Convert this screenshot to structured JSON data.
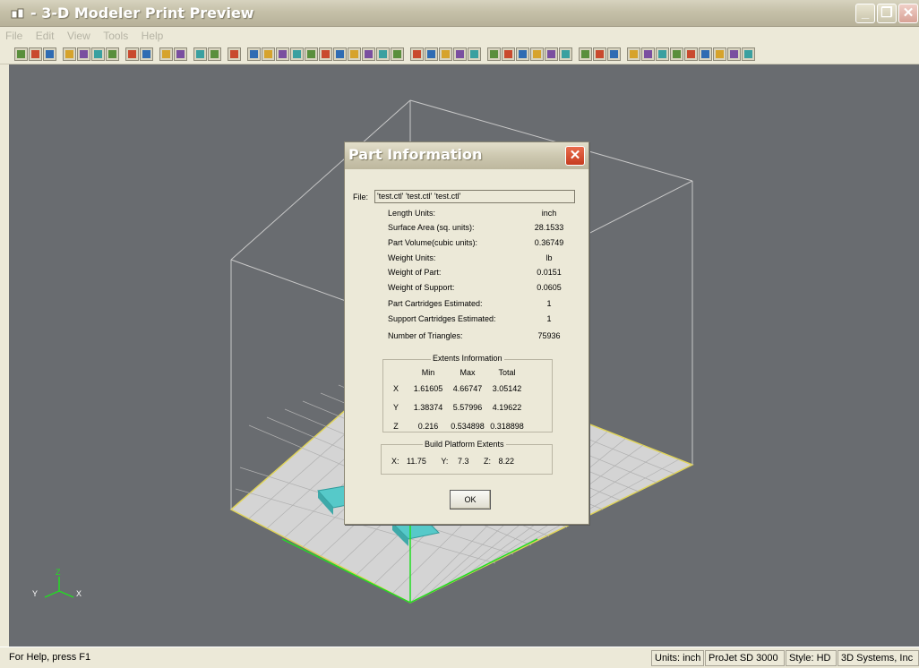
{
  "window": {
    "title": "- 3-D Modeler Print Preview",
    "minimize_glyph": "_",
    "maximize_glyph": "❐",
    "close_glyph": "✕"
  },
  "menu": {
    "items": [
      "File",
      "Edit",
      "View",
      "Tools",
      "Help"
    ]
  },
  "toolbar": {
    "button_count": 48
  },
  "viewport": {
    "background_color": "#696c70",
    "axis_labels": {
      "x": "X",
      "y": "Y",
      "z": "Z"
    }
  },
  "dialog": {
    "title": "Part Information",
    "close_glyph": "✕",
    "file_label": "File:",
    "file_value": "'test.ctl' 'test.ctl' 'test.ctl'",
    "rows": [
      {
        "label": "Length Units:",
        "value": "inch"
      },
      {
        "label": "Surface Area (sq. units):",
        "value": "28.1533"
      },
      {
        "label": "Part Volume(cubic units):",
        "value": "0.36749"
      },
      {
        "label": "Weight Units:",
        "value": "lb"
      },
      {
        "label": "Weight of Part:",
        "value": "0.0151"
      },
      {
        "label": "Weight of Support:",
        "value": "0.0605"
      },
      {
        "label": "Part Cartridges Estimated:",
        "value": "1"
      },
      {
        "label": "Support Cartridges Estimated:",
        "value": "1"
      },
      {
        "label": "Number of Triangles:",
        "value": "75936"
      }
    ],
    "extents": {
      "title": "Extents Information",
      "headers": [
        "Min",
        "Max",
        "Total"
      ],
      "rows": [
        {
          "axis": "X",
          "min": "1.61605",
          "max": "4.66747",
          "total": "3.05142"
        },
        {
          "axis": "Y",
          "min": "1.38374",
          "max": "5.57996",
          "total": "4.19622"
        },
        {
          "axis": "Z",
          "min": "0.216",
          "max": "0.534898",
          "total": "0.318898"
        }
      ]
    },
    "build_platform": {
      "title": "Build Platform Extents",
      "x_label": "X:",
      "x": "11.75",
      "y_label": "Y:",
      "y": "7.3",
      "z_label": "Z:",
      "z": "8.22"
    },
    "ok_label": "OK"
  },
  "status": {
    "help_text": "For Help, press F1",
    "units": "Units: inch",
    "printer": "ProJet SD 3000",
    "style": "Style: HD",
    "company": "3D Systems, Inc"
  }
}
